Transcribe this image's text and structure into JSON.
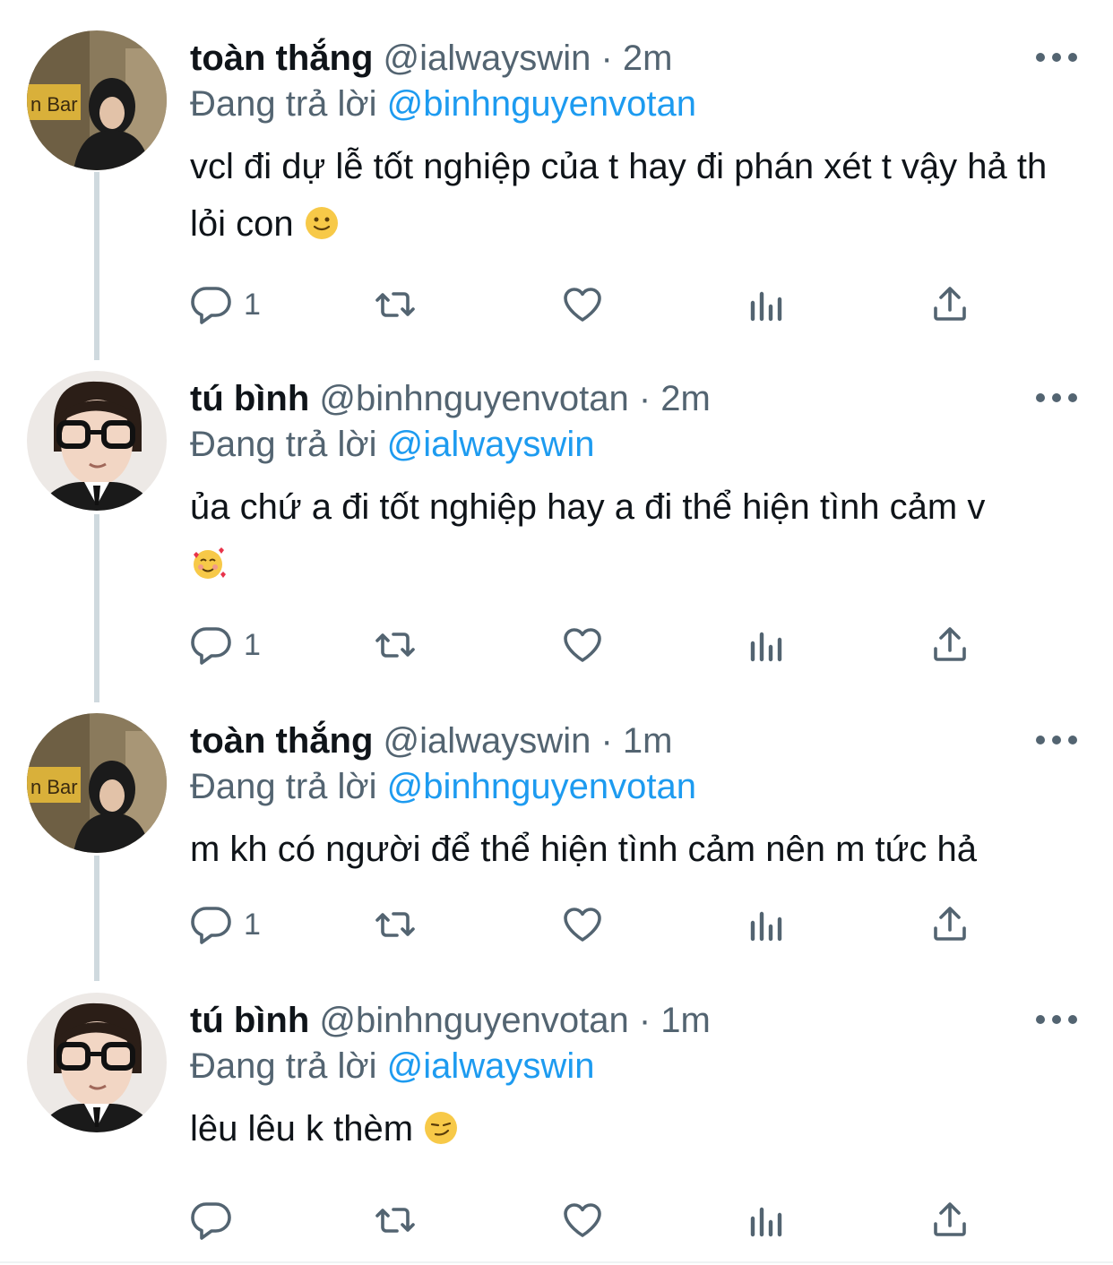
{
  "colors": {
    "text": "#0f1419",
    "secondary": "#536471",
    "mention": "#1d9bf0",
    "thread_line": "#cfd9de"
  },
  "tweets": [
    {
      "name": "toàn thắng",
      "handle": "@ialwayswin",
      "dot": "·",
      "time": "2m",
      "replying_label": "Đang trả lời",
      "replying_to": "@binhnguyenvotan",
      "text": "vcl đi dự lễ tốt nghiệp của t hay đi phán xét t vậy hả th lỏi con",
      "emoji": "slightly-smiling-face",
      "reply_count": "1",
      "avatar": "hooded-person-avatar"
    },
    {
      "name": "tú bình",
      "handle": "@binhnguyenvotan",
      "dot": "·",
      "time": "2m",
      "replying_label": "Đang trả lời",
      "replying_to": "@ialwayswin",
      "text": "ủa chứ a đi tốt nghiệp hay a đi thể hiện tình cảm v",
      "emoji": "smiling-face-with-hearts",
      "reply_count": "1",
      "avatar": "glasses-person-avatar"
    },
    {
      "name": "toàn thắng",
      "handle": "@ialwayswin",
      "dot": "·",
      "time": "1m",
      "replying_label": "Đang trả lời",
      "replying_to": "@binhnguyenvotan",
      "text": "m kh có người để thể hiện tình cảm nên m tức hả",
      "emoji": "",
      "reply_count": "1",
      "avatar": "hooded-person-avatar"
    },
    {
      "name": "tú bình",
      "handle": "@binhnguyenvotan",
      "dot": "·",
      "time": "1m",
      "replying_label": "Đang trả lời",
      "replying_to": "@ialwayswin",
      "text": "lêu lêu k thèm",
      "emoji": "smirking-face",
      "reply_count": "",
      "avatar": "glasses-person-avatar"
    }
  ],
  "icons": {
    "reply": "reply-icon",
    "retweet": "retweet-icon",
    "like": "heart-icon",
    "views": "views-icon",
    "share": "share-icon",
    "more": "more-icon"
  }
}
